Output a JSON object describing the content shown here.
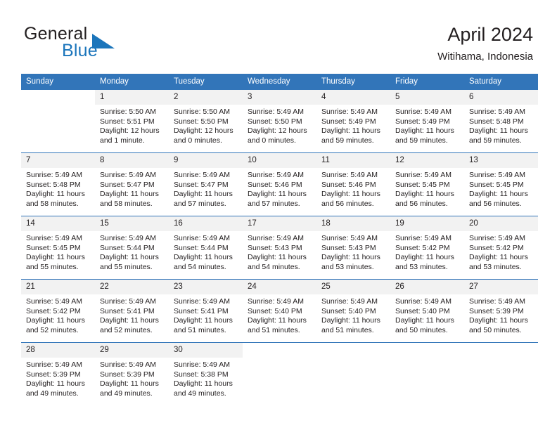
{
  "brand": {
    "word_one": "General",
    "word_two": "Blue",
    "accent_color": "#1b75bb",
    "logo_icon": "triangle-logo-icon"
  },
  "header": {
    "title": "April 2024",
    "subtitle": "Witihama, Indonesia"
  },
  "calendar": {
    "header_color": "#3275b9",
    "daynum_band_color": "#f2f2f2",
    "columns": [
      "Sunday",
      "Monday",
      "Tuesday",
      "Wednesday",
      "Thursday",
      "Friday",
      "Saturday"
    ],
    "weeks": [
      [
        {
          "day": "",
          "sunrise": "",
          "sunset": "",
          "daylight": "",
          "blank": true
        },
        {
          "day": "1",
          "sunrise": "Sunrise: 5:50 AM",
          "sunset": "Sunset: 5:51 PM",
          "daylight": "Daylight: 12 hours and 1 minute."
        },
        {
          "day": "2",
          "sunrise": "Sunrise: 5:50 AM",
          "sunset": "Sunset: 5:50 PM",
          "daylight": "Daylight: 12 hours and 0 minutes."
        },
        {
          "day": "3",
          "sunrise": "Sunrise: 5:49 AM",
          "sunset": "Sunset: 5:50 PM",
          "daylight": "Daylight: 12 hours and 0 minutes."
        },
        {
          "day": "4",
          "sunrise": "Sunrise: 5:49 AM",
          "sunset": "Sunset: 5:49 PM",
          "daylight": "Daylight: 11 hours and 59 minutes."
        },
        {
          "day": "5",
          "sunrise": "Sunrise: 5:49 AM",
          "sunset": "Sunset: 5:49 PM",
          "daylight": "Daylight: 11 hours and 59 minutes."
        },
        {
          "day": "6",
          "sunrise": "Sunrise: 5:49 AM",
          "sunset": "Sunset: 5:48 PM",
          "daylight": "Daylight: 11 hours and 59 minutes."
        }
      ],
      [
        {
          "day": "7",
          "sunrise": "Sunrise: 5:49 AM",
          "sunset": "Sunset: 5:48 PM",
          "daylight": "Daylight: 11 hours and 58 minutes."
        },
        {
          "day": "8",
          "sunrise": "Sunrise: 5:49 AM",
          "sunset": "Sunset: 5:47 PM",
          "daylight": "Daylight: 11 hours and 58 minutes."
        },
        {
          "day": "9",
          "sunrise": "Sunrise: 5:49 AM",
          "sunset": "Sunset: 5:47 PM",
          "daylight": "Daylight: 11 hours and 57 minutes."
        },
        {
          "day": "10",
          "sunrise": "Sunrise: 5:49 AM",
          "sunset": "Sunset: 5:46 PM",
          "daylight": "Daylight: 11 hours and 57 minutes."
        },
        {
          "day": "11",
          "sunrise": "Sunrise: 5:49 AM",
          "sunset": "Sunset: 5:46 PM",
          "daylight": "Daylight: 11 hours and 56 minutes."
        },
        {
          "day": "12",
          "sunrise": "Sunrise: 5:49 AM",
          "sunset": "Sunset: 5:45 PM",
          "daylight": "Daylight: 11 hours and 56 minutes."
        },
        {
          "day": "13",
          "sunrise": "Sunrise: 5:49 AM",
          "sunset": "Sunset: 5:45 PM",
          "daylight": "Daylight: 11 hours and 56 minutes."
        }
      ],
      [
        {
          "day": "14",
          "sunrise": "Sunrise: 5:49 AM",
          "sunset": "Sunset: 5:45 PM",
          "daylight": "Daylight: 11 hours and 55 minutes."
        },
        {
          "day": "15",
          "sunrise": "Sunrise: 5:49 AM",
          "sunset": "Sunset: 5:44 PM",
          "daylight": "Daylight: 11 hours and 55 minutes."
        },
        {
          "day": "16",
          "sunrise": "Sunrise: 5:49 AM",
          "sunset": "Sunset: 5:44 PM",
          "daylight": "Daylight: 11 hours and 54 minutes."
        },
        {
          "day": "17",
          "sunrise": "Sunrise: 5:49 AM",
          "sunset": "Sunset: 5:43 PM",
          "daylight": "Daylight: 11 hours and 54 minutes."
        },
        {
          "day": "18",
          "sunrise": "Sunrise: 5:49 AM",
          "sunset": "Sunset: 5:43 PM",
          "daylight": "Daylight: 11 hours and 53 minutes."
        },
        {
          "day": "19",
          "sunrise": "Sunrise: 5:49 AM",
          "sunset": "Sunset: 5:42 PM",
          "daylight": "Daylight: 11 hours and 53 minutes."
        },
        {
          "day": "20",
          "sunrise": "Sunrise: 5:49 AM",
          "sunset": "Sunset: 5:42 PM",
          "daylight": "Daylight: 11 hours and 53 minutes."
        }
      ],
      [
        {
          "day": "21",
          "sunrise": "Sunrise: 5:49 AM",
          "sunset": "Sunset: 5:42 PM",
          "daylight": "Daylight: 11 hours and 52 minutes."
        },
        {
          "day": "22",
          "sunrise": "Sunrise: 5:49 AM",
          "sunset": "Sunset: 5:41 PM",
          "daylight": "Daylight: 11 hours and 52 minutes."
        },
        {
          "day": "23",
          "sunrise": "Sunrise: 5:49 AM",
          "sunset": "Sunset: 5:41 PM",
          "daylight": "Daylight: 11 hours and 51 minutes."
        },
        {
          "day": "24",
          "sunrise": "Sunrise: 5:49 AM",
          "sunset": "Sunset: 5:40 PM",
          "daylight": "Daylight: 11 hours and 51 minutes."
        },
        {
          "day": "25",
          "sunrise": "Sunrise: 5:49 AM",
          "sunset": "Sunset: 5:40 PM",
          "daylight": "Daylight: 11 hours and 51 minutes."
        },
        {
          "day": "26",
          "sunrise": "Sunrise: 5:49 AM",
          "sunset": "Sunset: 5:40 PM",
          "daylight": "Daylight: 11 hours and 50 minutes."
        },
        {
          "day": "27",
          "sunrise": "Sunrise: 5:49 AM",
          "sunset": "Sunset: 5:39 PM",
          "daylight": "Daylight: 11 hours and 50 minutes."
        }
      ],
      [
        {
          "day": "28",
          "sunrise": "Sunrise: 5:49 AM",
          "sunset": "Sunset: 5:39 PM",
          "daylight": "Daylight: 11 hours and 49 minutes."
        },
        {
          "day": "29",
          "sunrise": "Sunrise: 5:49 AM",
          "sunset": "Sunset: 5:39 PM",
          "daylight": "Daylight: 11 hours and 49 minutes."
        },
        {
          "day": "30",
          "sunrise": "Sunrise: 5:49 AM",
          "sunset": "Sunset: 5:38 PM",
          "daylight": "Daylight: 11 hours and 49 minutes."
        },
        {
          "day": "",
          "sunrise": "",
          "sunset": "",
          "daylight": "",
          "blank": true
        },
        {
          "day": "",
          "sunrise": "",
          "sunset": "",
          "daylight": "",
          "blank": true
        },
        {
          "day": "",
          "sunrise": "",
          "sunset": "",
          "daylight": "",
          "blank": true
        },
        {
          "day": "",
          "sunrise": "",
          "sunset": "",
          "daylight": "",
          "blank": true
        }
      ]
    ]
  }
}
